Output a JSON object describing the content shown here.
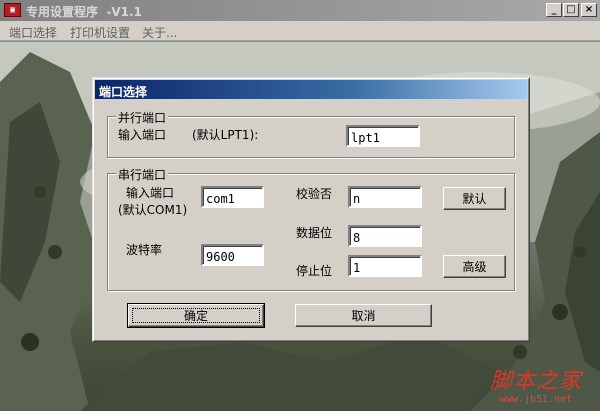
{
  "window": {
    "title": "专用设置程序  -V1.1",
    "app_icon": "app-icon",
    "controls": [
      "minimize-icon",
      "maximize-icon",
      "close-icon"
    ]
  },
  "menu": {
    "items": [
      {
        "label": "端口选择"
      },
      {
        "label": "打印机设置"
      },
      {
        "label": "关于..."
      }
    ]
  },
  "dialog": {
    "title": "端口选择",
    "parallel": {
      "group_label": "并行端口",
      "input_label": "输入端口",
      "default_hint": "(默认LPT1):",
      "input_value": "lpt1"
    },
    "serial": {
      "group_label": "串行端口",
      "input_label": "输入端口",
      "input_hint": "(默认COM1)",
      "input_value": "com1",
      "baud_label": "波特率",
      "baud_value": "9600",
      "parity_label": "校验否",
      "parity_value": "n",
      "databits_label": "数据位",
      "databits_value": "8",
      "stopbits_label": "停止位",
      "stopbits_value": "1",
      "default_button": "默认",
      "advanced_button": "高级"
    },
    "ok_button": "确定",
    "cancel_button": "取消"
  },
  "watermark": {
    "main": "脚本之家",
    "url": "www.jb51.net"
  },
  "colors": {
    "dialog_title_start": "#0a246a",
    "dialog_title_end": "#a6caf0",
    "watermark": "#d63a2a",
    "face": "#d4d0c8"
  }
}
